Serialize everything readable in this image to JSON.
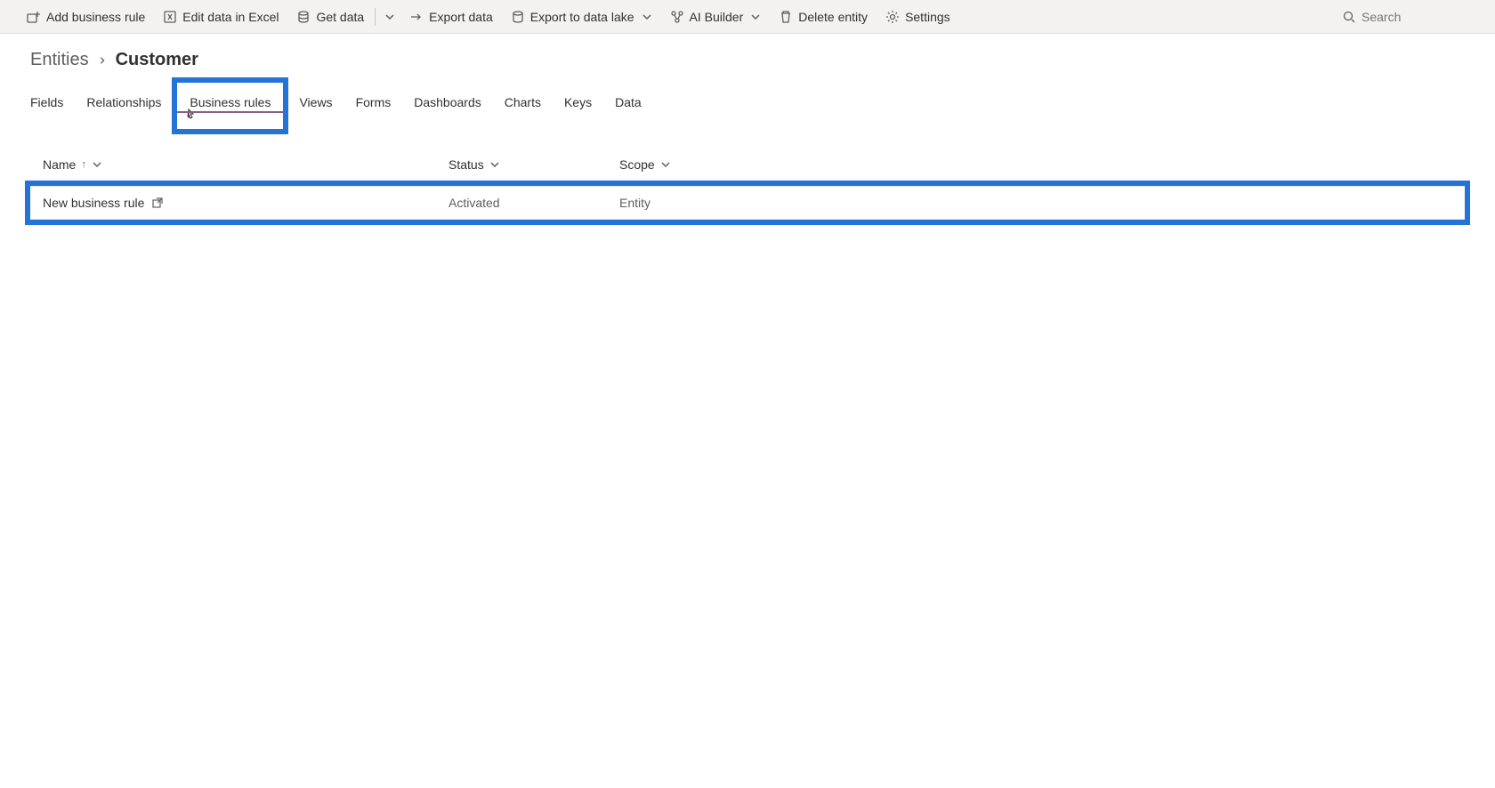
{
  "toolbar": {
    "add_rule": "Add business rule",
    "edit_excel": "Edit data in Excel",
    "get_data": "Get data",
    "export_data": "Export data",
    "export_lake": "Export to data lake",
    "ai_builder": "AI Builder",
    "delete_entity": "Delete entity",
    "settings": "Settings",
    "search_placeholder": "Search"
  },
  "breadcrumb": {
    "root": "Entities",
    "current": "Customer"
  },
  "tabs": {
    "fields": "Fields",
    "relationships": "Relationships",
    "business_rules": "Business rules",
    "views": "Views",
    "forms": "Forms",
    "dashboards": "Dashboards",
    "charts": "Charts",
    "keys": "Keys",
    "data": "Data",
    "active": "business_rules"
  },
  "columns": {
    "name": "Name",
    "status": "Status",
    "scope": "Scope"
  },
  "rows": [
    {
      "name": "New business rule",
      "status": "Activated",
      "scope": "Entity"
    }
  ]
}
